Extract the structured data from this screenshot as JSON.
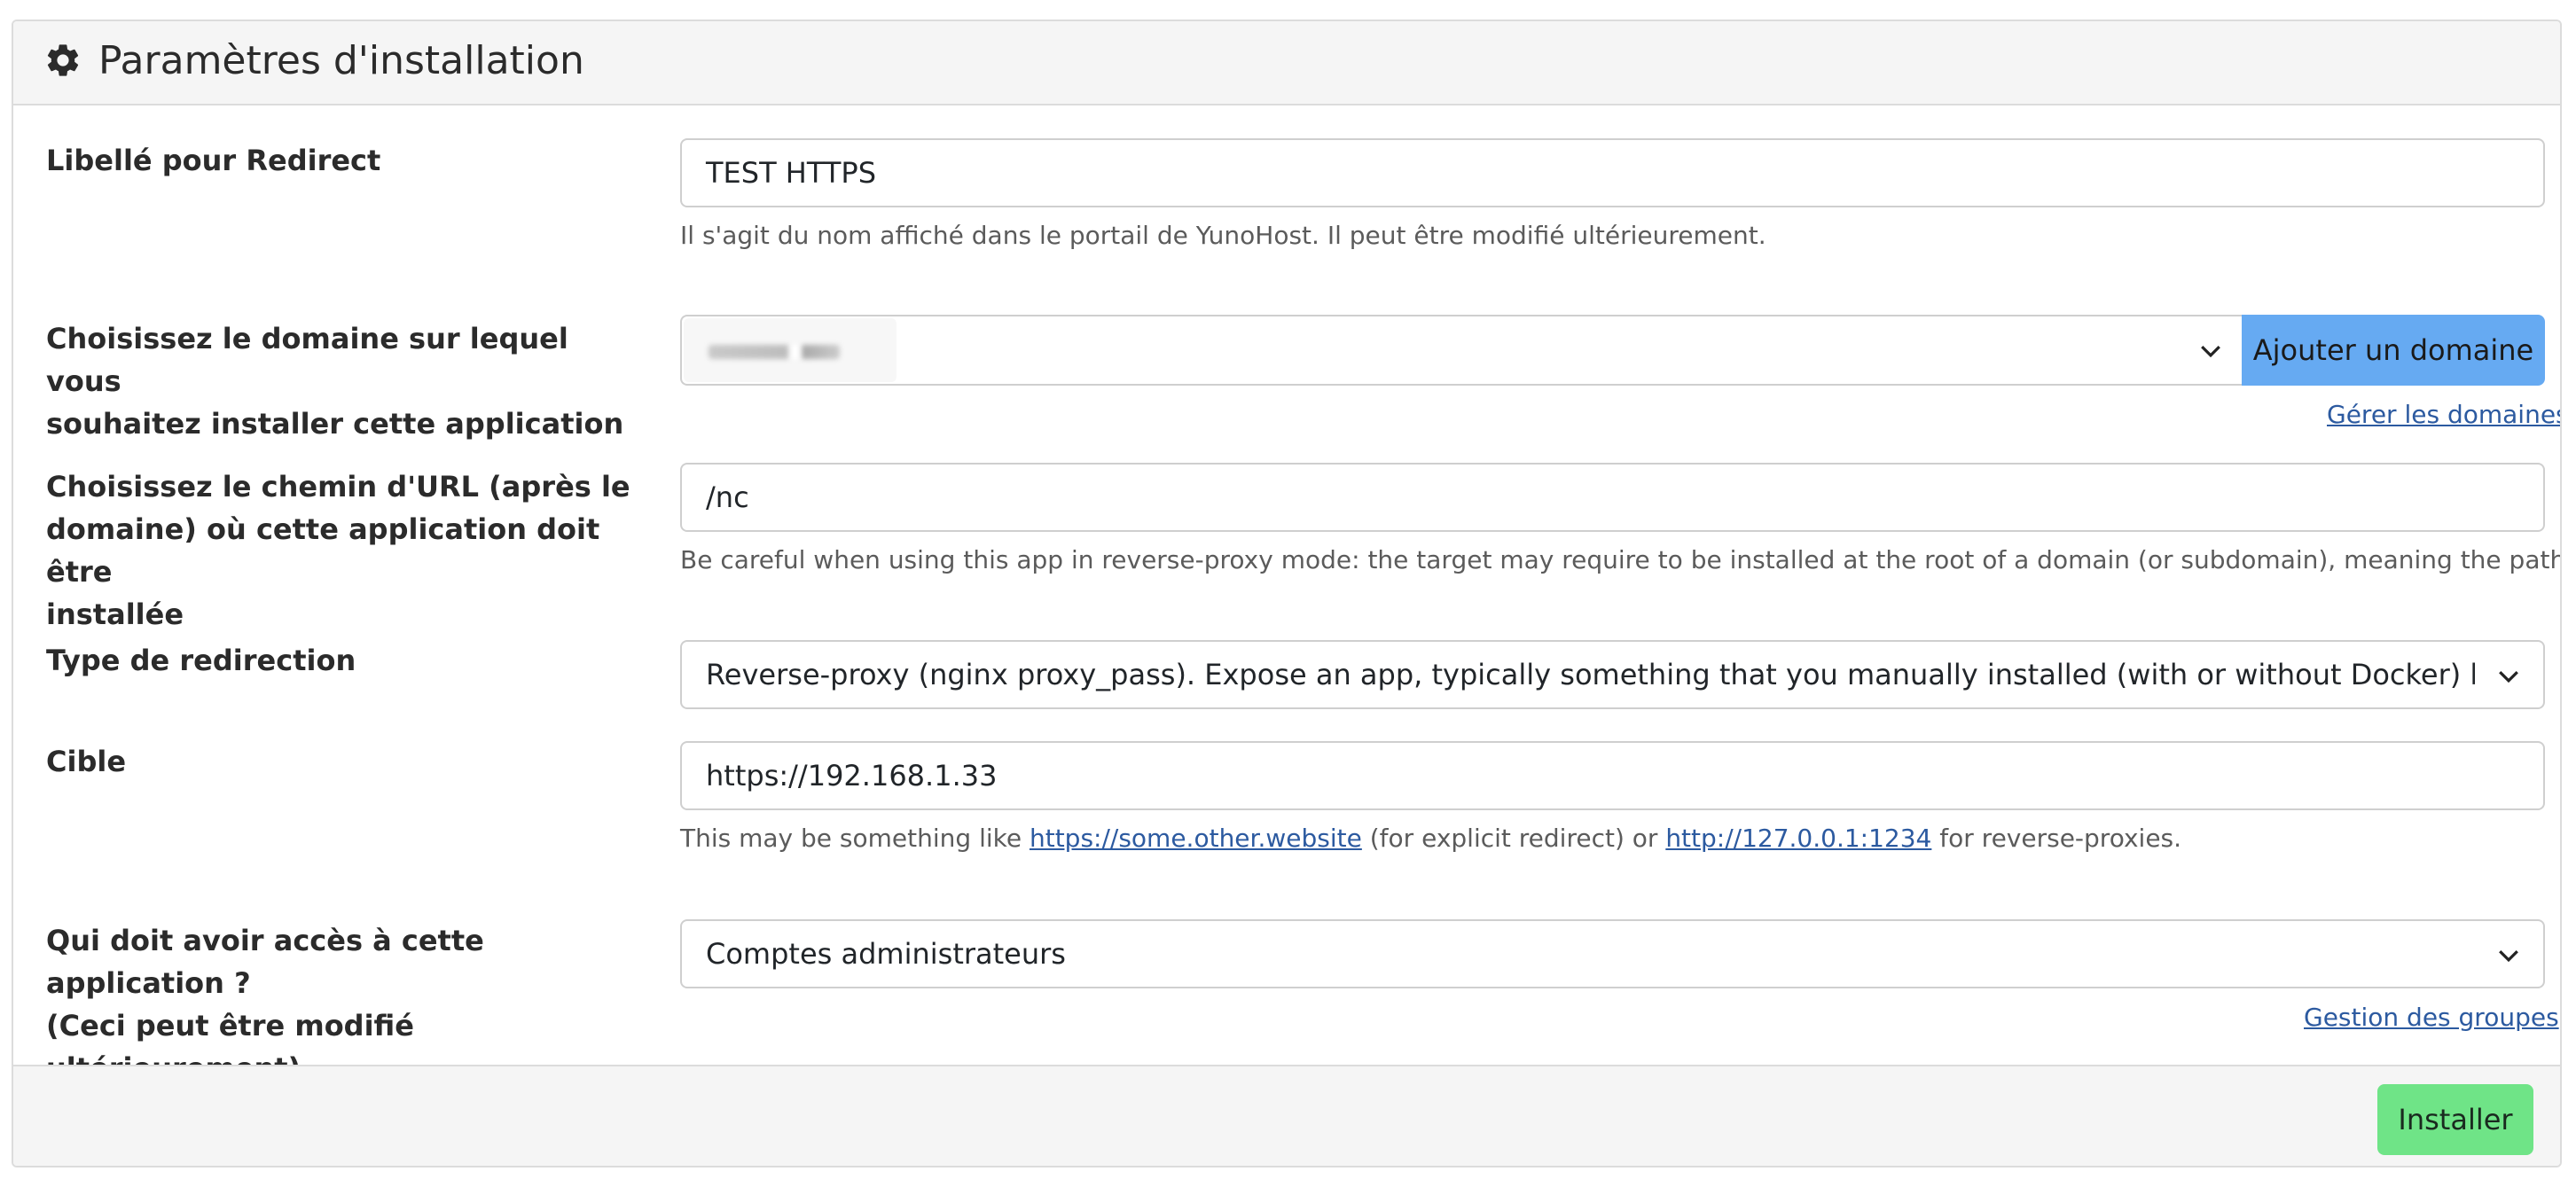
{
  "header": {
    "title": "Paramètres d'installation",
    "icon": "gear-icon"
  },
  "fields": {
    "label": {
      "label": "Libellé pour Redirect",
      "value": "TEST HTTPS",
      "help": "Il s'agit du nom affiché dans le portail de YunoHost. Il peut être modifié ultérieurement."
    },
    "domain": {
      "label_line1": "Choisissez le domaine sur lequel vous",
      "label_line2": "souhaitez installer cette application",
      "add_button": "Ajouter un domaine",
      "manage_link": "Gérer les domaines"
    },
    "path": {
      "label_line1": "Choisissez le chemin d'URL (après le",
      "label_line2": "domaine) où cette application doit être",
      "label_line3": "installée",
      "value": "/nc",
      "help": "Be careful when using this app in reverse-proxy mode: the target may require to be installed at the root of a domain (or subdomain), meaning the path is just '/'!"
    },
    "redirect_type": {
      "label": "Type de redirection",
      "value": "Reverse-proxy (nginx proxy_pass). Expose an app, typically something that you manually installed (with or without Docker) locally or an a"
    },
    "target": {
      "label": "Cible",
      "value": "https://192.168.1.33",
      "help_prefix": "This may be something like ",
      "help_link1": "https://some.other.website",
      "help_middle": " (for explicit redirect) or ",
      "help_link2": "http://127.0.0.1:1234",
      "help_suffix": " for reverse-proxies."
    },
    "access": {
      "label_line1": "Qui doit avoir accès à cette application ?",
      "label_line2": "(Ceci peut être modifié ultérieurement)",
      "value": "Comptes administrateurs",
      "groups_link": "Gestion des groupes"
    }
  },
  "footer": {
    "install_button": "Installer"
  },
  "colors": {
    "primary": "#66aaf2",
    "success": "#6fe487",
    "link": "#2c5aa0"
  }
}
